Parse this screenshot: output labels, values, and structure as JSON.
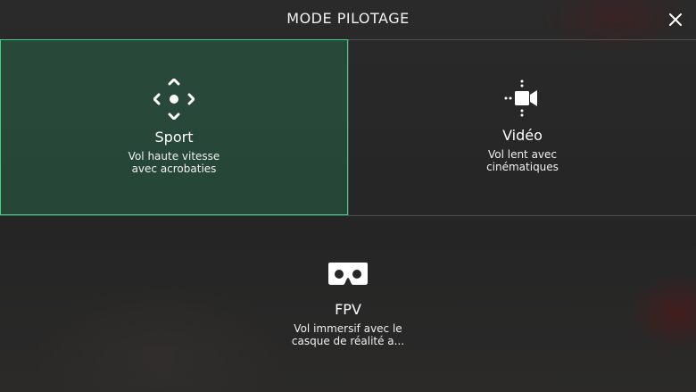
{
  "header": {
    "title": "MODE PILOTAGE",
    "close_icon": "close-icon"
  },
  "modes": [
    {
      "name": "Sport",
      "icon": "directional-move-icon",
      "desc_line1": "Vol haute vitesse",
      "desc_line2": "avec acrobaties",
      "selected": true
    },
    {
      "name": "Vidéo",
      "icon": "video-camera-icon",
      "desc_line1": "Vol lent avec",
      "desc_line2": "cinématiques",
      "selected": false
    },
    {
      "name": "FPV",
      "icon": "vr-headset-icon",
      "desc_line1": "Vol immersif avec le",
      "desc_line2": "casque de réalité a...",
      "selected": false
    }
  ],
  "colors": {
    "accent": "#3fd18a",
    "selected_fill": "#286e50"
  }
}
